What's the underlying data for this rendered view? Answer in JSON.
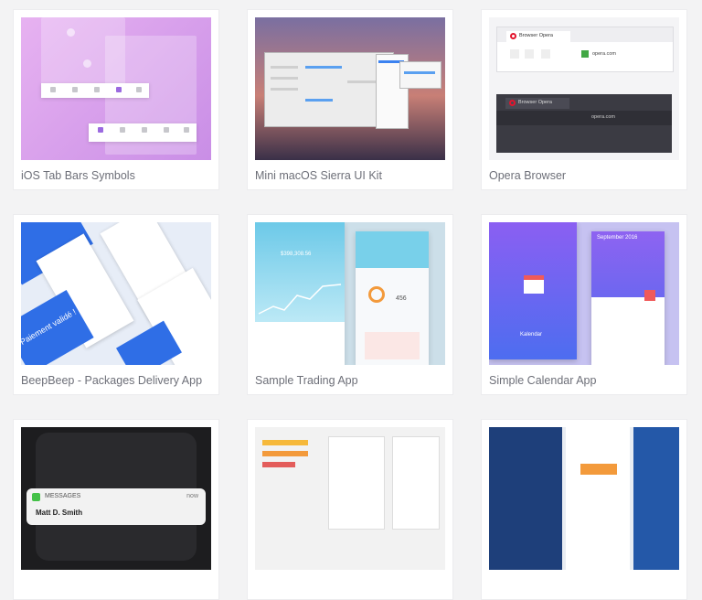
{
  "cards": [
    {
      "title": "iOS Tab Bars Symbols"
    },
    {
      "title": "Mini macOS Sierra UI Kit"
    },
    {
      "title": "Opera Browser"
    },
    {
      "title": "BeepBeep - Packages Delivery App"
    },
    {
      "title": "Sample Trading App"
    },
    {
      "title": "Simple Calendar App"
    },
    {
      "title": ""
    },
    {
      "title": ""
    },
    {
      "title": ""
    }
  ],
  "thumbs": {
    "opera": {
      "tab_label": "Browser Opera",
      "url": "opera.com"
    },
    "trading": {
      "balance": "$398,308.56",
      "gauge_value": "456"
    },
    "calendar": {
      "month": "September 2016",
      "label": "Kalendar"
    },
    "beep": {
      "banner": "Paiement validé !"
    },
    "messages": {
      "app": "MESSAGES",
      "time": "now",
      "sender": "Matt D. Smith"
    }
  },
  "colors": {
    "page_bg": "#f3f3f4",
    "card_bg": "#ffffff",
    "title_text": "#6d6f78",
    "opera_red": "#e2142d",
    "beep_blue": "#2f6ee6",
    "calendar_purple": "#6b5cf0",
    "message_green": "#44c148"
  }
}
